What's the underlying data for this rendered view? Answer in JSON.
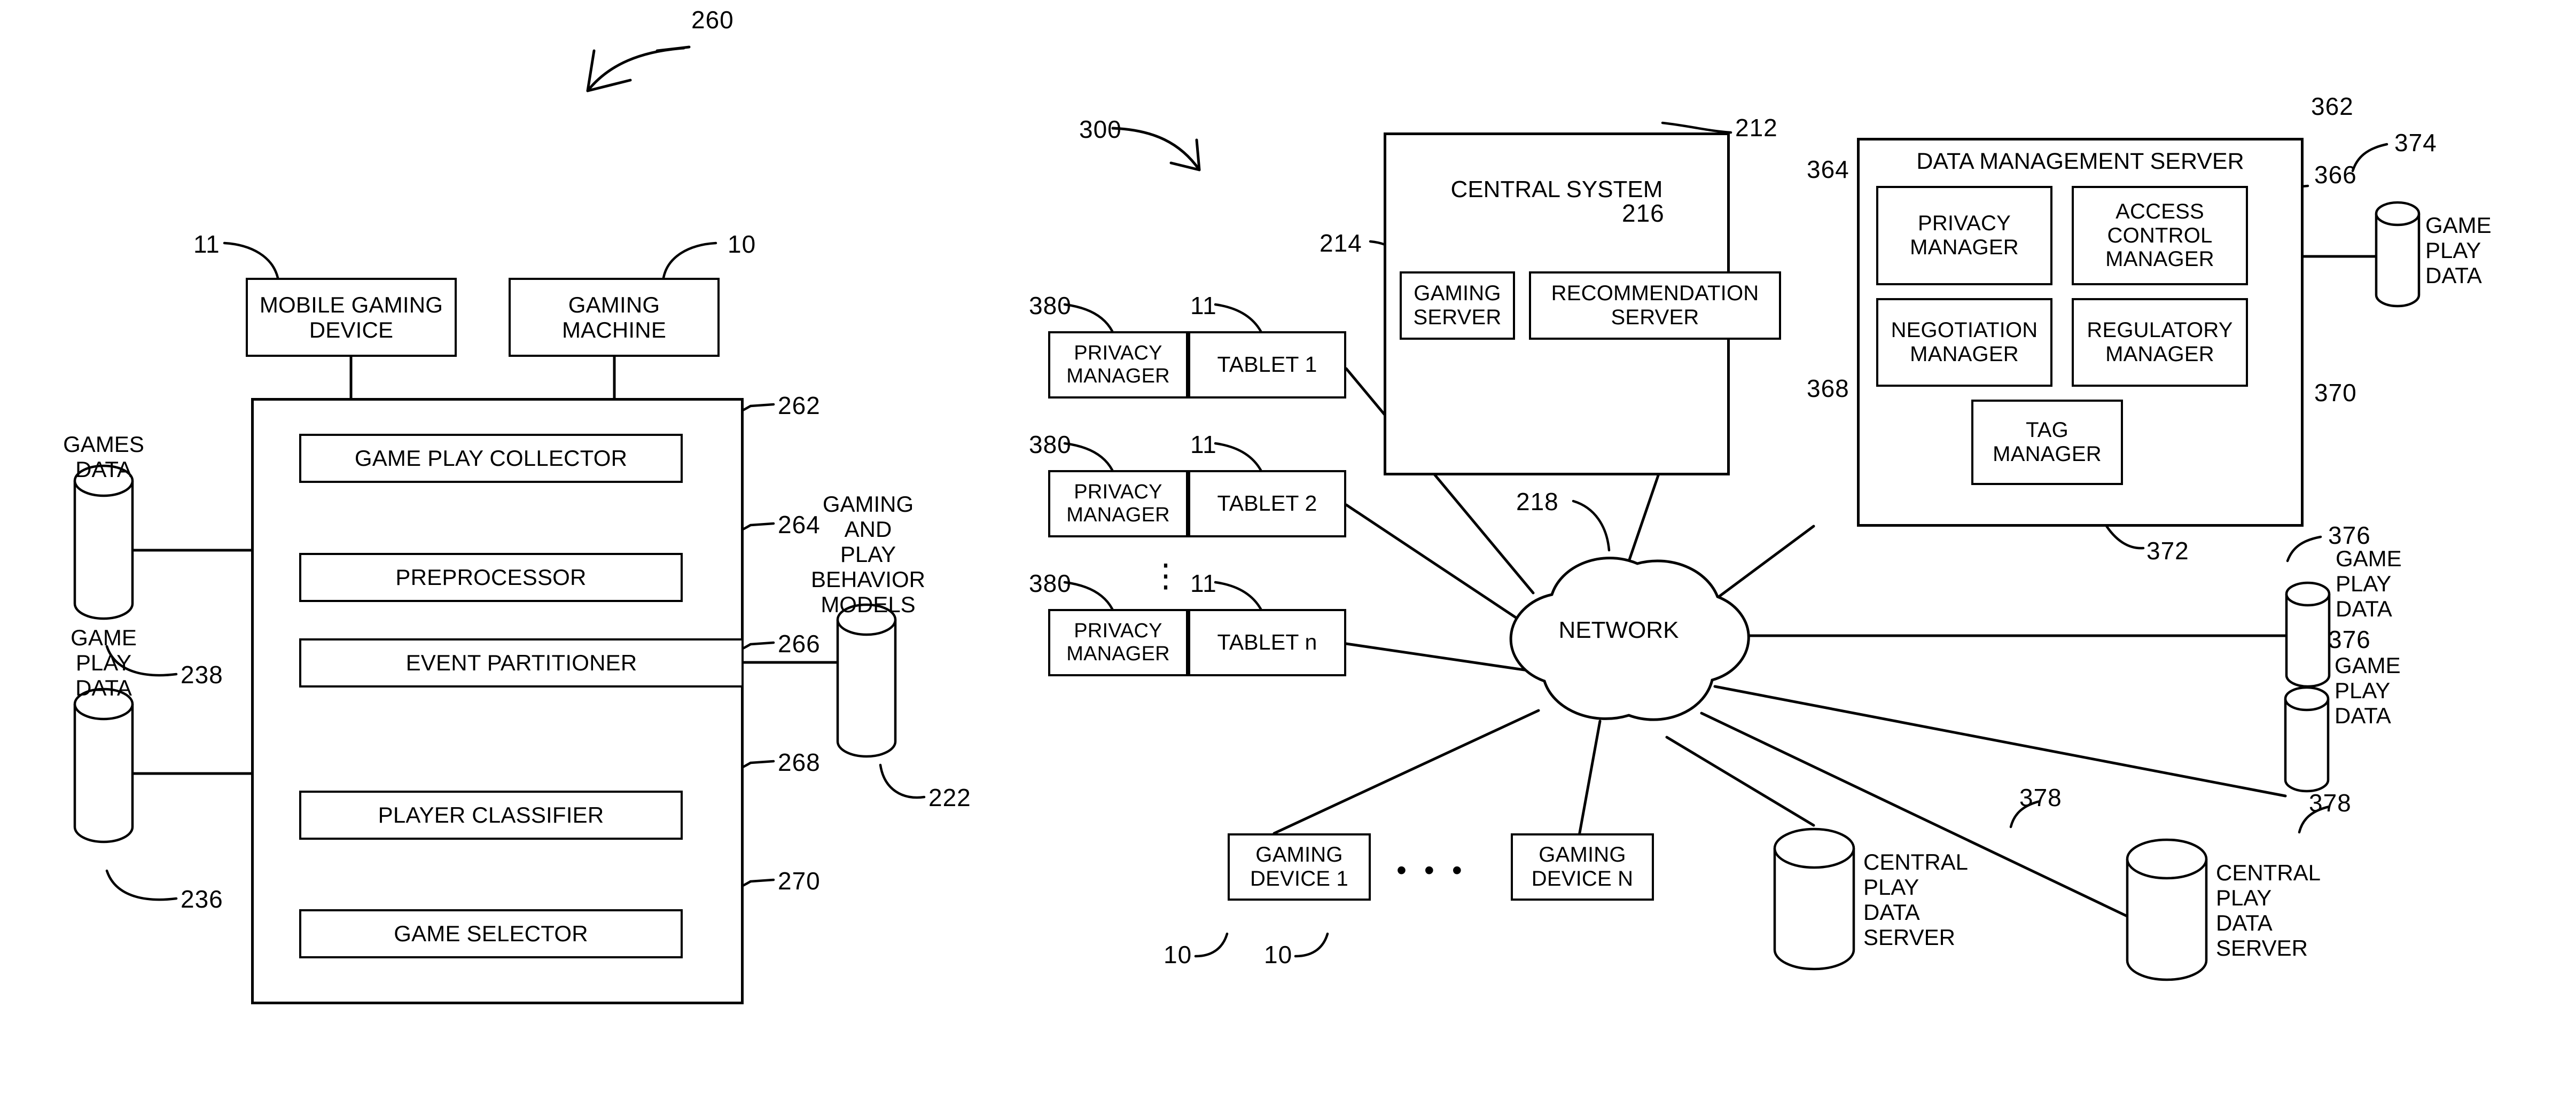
{
  "figures": {
    "left": {
      "ref": "260",
      "top_boxes": [
        {
          "label": "MOBILE GAMING\nDEVICE",
          "ref": "11"
        },
        {
          "label": "GAMING\nMACHINE",
          "ref": "10"
        }
      ],
      "modules": [
        {
          "label": "GAME PLAY COLLECTOR",
          "ref": "262"
        },
        {
          "label": "PREPROCESSOR",
          "ref": "264"
        },
        {
          "label": "EVENT PARTITIONER",
          "ref": "266"
        },
        {
          "label": "PLAYER CLASSIFIER",
          "ref": "268"
        },
        {
          "label": "GAME SELECTOR",
          "ref": "270"
        }
      ],
      "left_stores": [
        {
          "label": "GAMES\nDATA",
          "ref": "238"
        },
        {
          "label": "GAME\nPLAY\nDATA",
          "ref": "236"
        }
      ],
      "right_store": {
        "label": "GAMING\nAND\nPLAY\nBEHAVIOR\nMODELS",
        "ref": "222"
      }
    },
    "right": {
      "ref": "300",
      "central_system": {
        "title": "CENTRAL SYSTEM",
        "ref": "212",
        "children": [
          {
            "label": "GAMING\nSERVER",
            "ref": "214"
          },
          {
            "label": "RECOMMENDATION\nSERVER",
            "ref": "216"
          }
        ]
      },
      "data_management_server": {
        "title": "DATA MANAGEMENT SERVER",
        "ref": "362",
        "children": [
          {
            "label": "PRIVACY\nMANAGER",
            "ref": "364"
          },
          {
            "label": "ACCESS\nCONTROL\nMANAGER",
            "ref": "366"
          },
          {
            "label": "NEGOTIATION\nMANAGER",
            "ref": "368"
          },
          {
            "label": "REGULATORY\nMANAGER",
            "ref": "370"
          },
          {
            "label": "TAG\nMANAGER",
            "ref": "372"
          }
        ]
      },
      "network": {
        "label": "NETWORK",
        "ref": "218"
      },
      "tablets": [
        {
          "privacy": "PRIVACY\nMANAGER",
          "privacy_ref": "380",
          "tablet": "TABLET 1",
          "tablet_ref": "11"
        },
        {
          "privacy": "PRIVACY\nMANAGER",
          "privacy_ref": "380",
          "tablet": "TABLET 2",
          "tablet_ref": "11"
        },
        {
          "privacy": "PRIVACY\nMANAGER",
          "privacy_ref": "380",
          "tablet": "TABLET n",
          "tablet_ref": "11"
        }
      ],
      "tablet_ellipsis": "⋮",
      "gaming_devices": [
        {
          "label": "GAMING\nDEVICE 1",
          "ref": "10"
        },
        {
          "label": "GAMING\nDEVICE N",
          "ref": "10"
        }
      ],
      "device_ellipsis": "• • •",
      "game_play_stores": [
        {
          "label": "GAME\nPLAY\nDATA",
          "ref": "374"
        },
        {
          "label": "GAME\nPLAY\nDATA",
          "ref": "376"
        },
        {
          "label": "GAME\nPLAY\nDATA",
          "ref": "376"
        }
      ],
      "central_play_stores": [
        {
          "label": "CENTRAL\nPLAY\nDATA\nSERVER",
          "ref": "378"
        },
        {
          "label": "CENTRAL\nPLAY\nDATA\nSERVER",
          "ref": "378"
        }
      ]
    }
  },
  "colors": {
    "ink": "#000000",
    "paper": "#ffffff"
  }
}
